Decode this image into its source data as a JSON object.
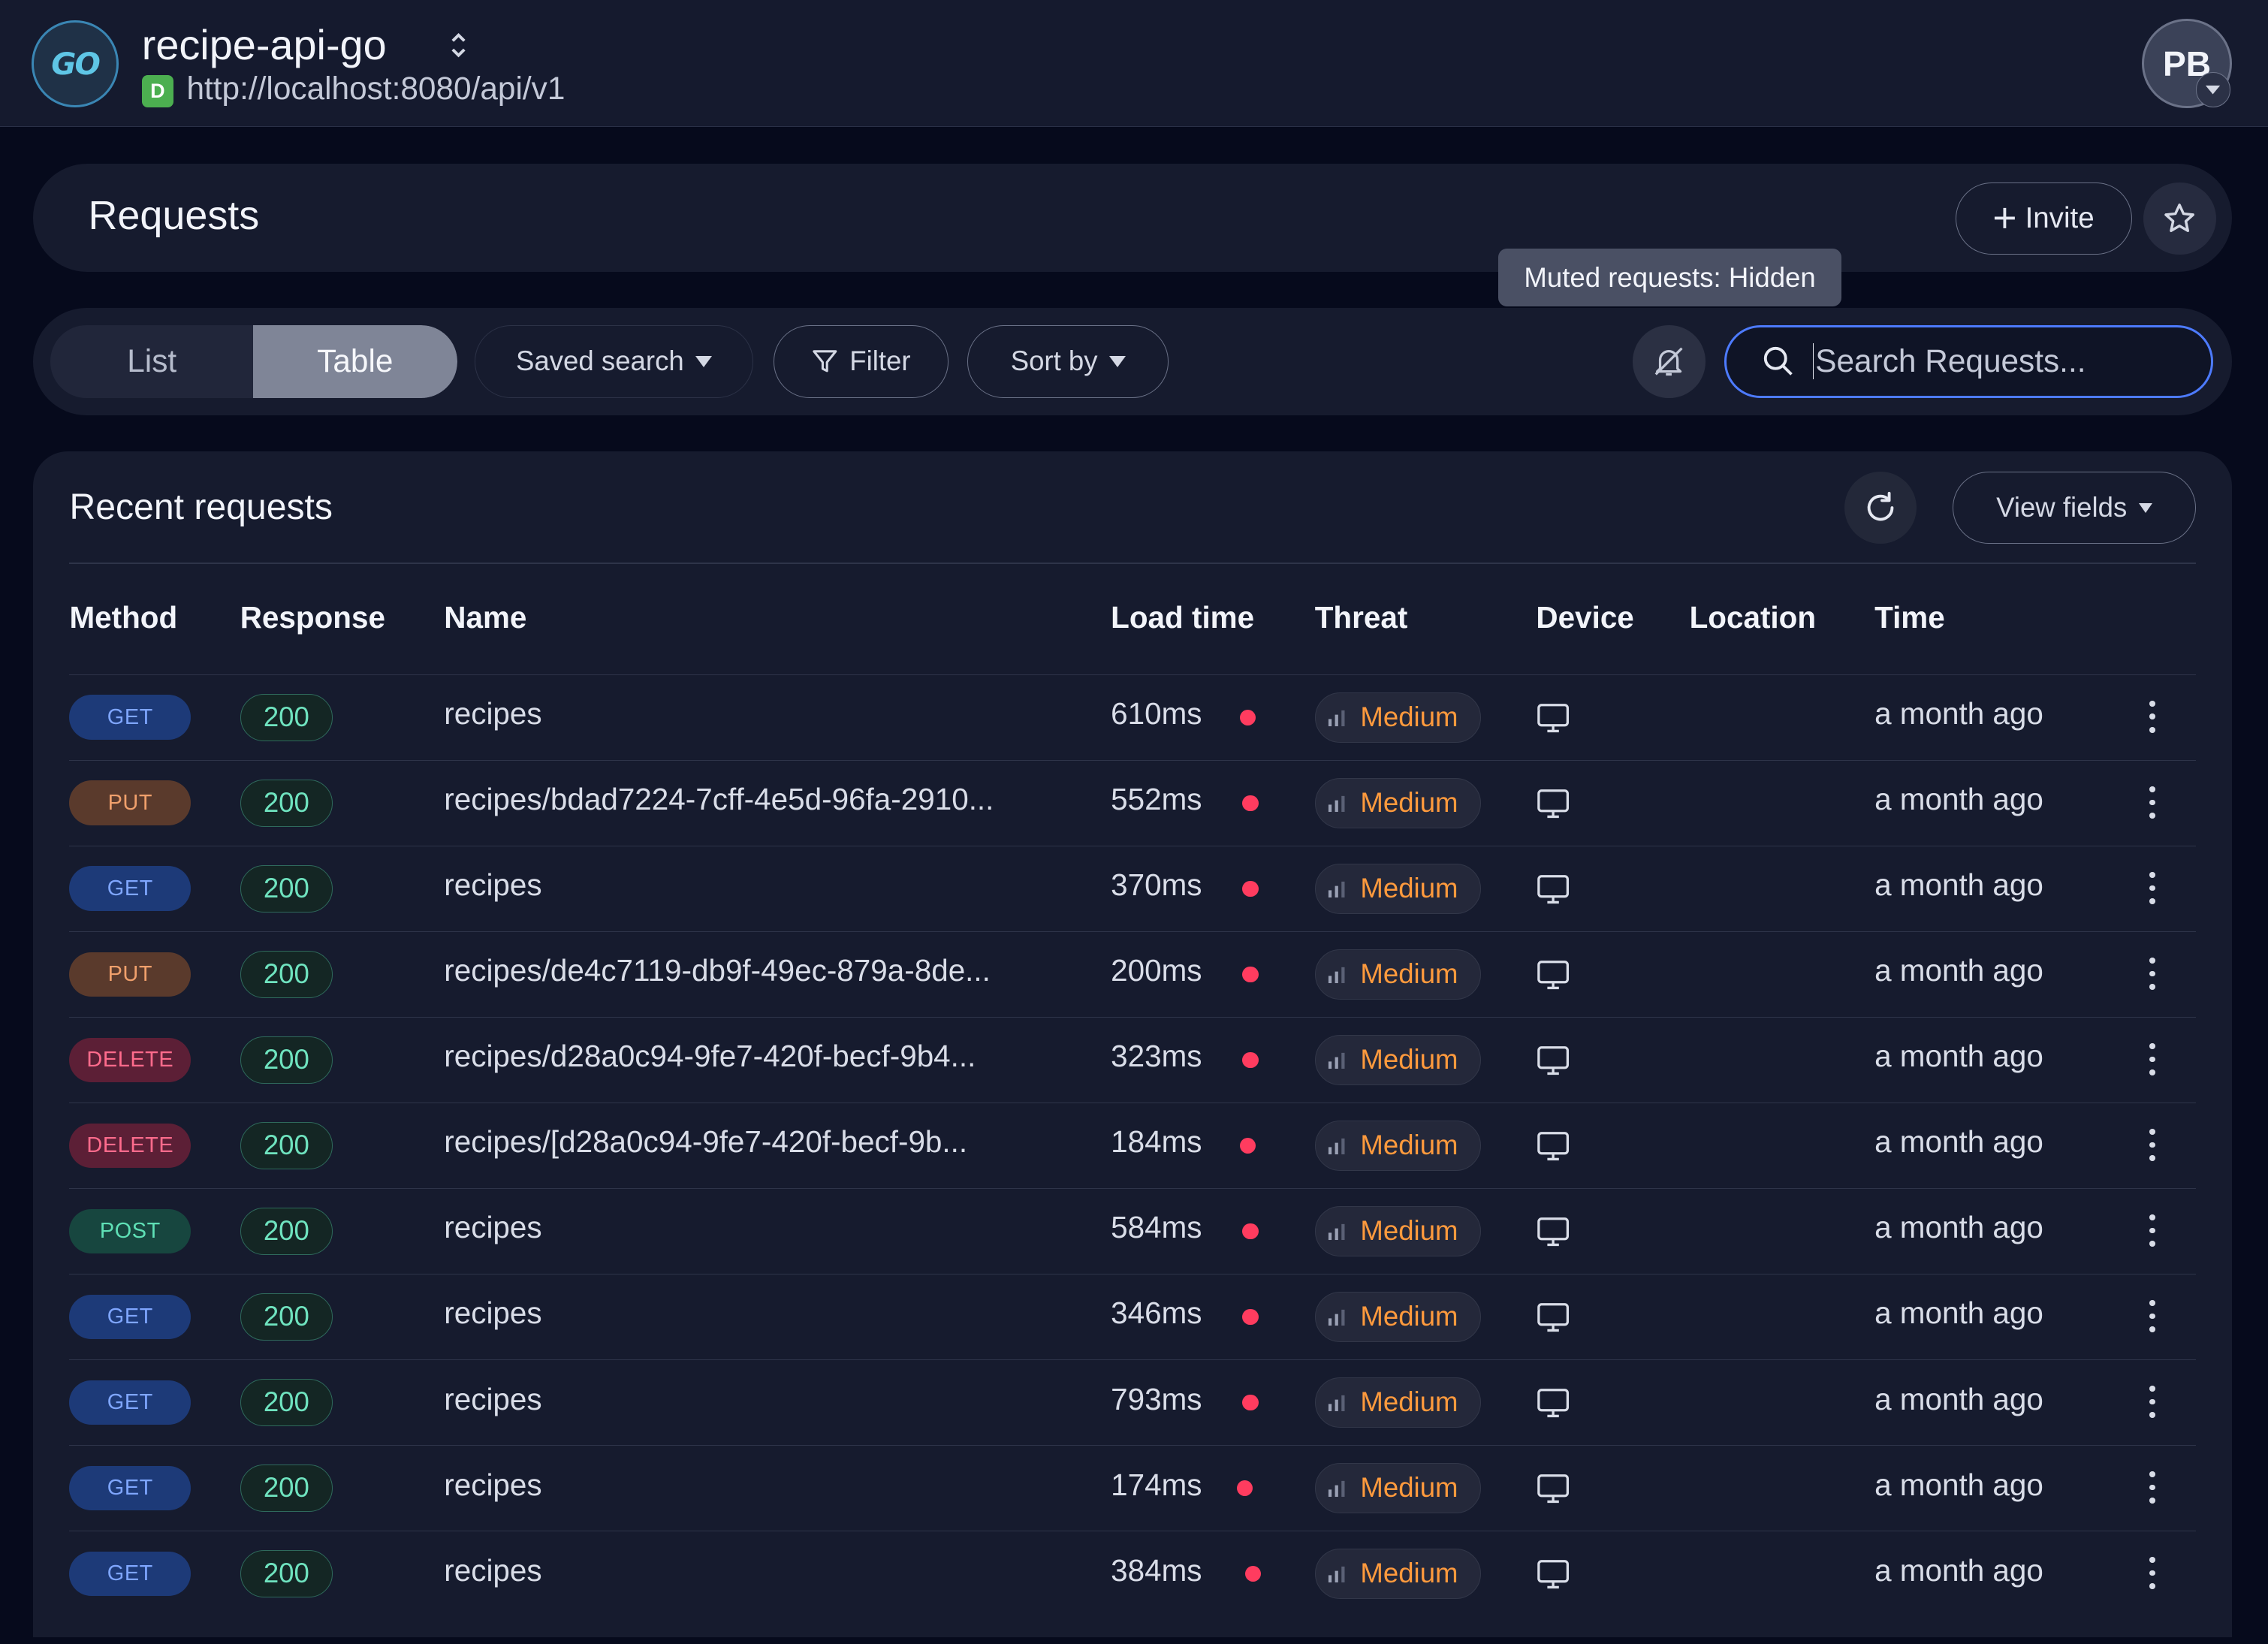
{
  "header": {
    "logo_text": "GO",
    "project_name": "recipe-api-go",
    "env_badge": "D",
    "base_url": "http://localhost:8080/api/v1",
    "avatar_initials": "PB"
  },
  "requests_panel": {
    "title": "Requests",
    "invite_label": "Invite"
  },
  "tooltip": "Muted requests: Hidden",
  "toolbar": {
    "view_list": "List",
    "view_table": "Table",
    "active_view": "Table",
    "saved_search": "Saved search",
    "filter": "Filter",
    "sort_by": "Sort by",
    "search_placeholder": "Search Requests..."
  },
  "table": {
    "title": "Recent requests",
    "view_fields": "View fields",
    "columns": [
      "Method",
      "Response",
      "Name",
      "Load time",
      "Threat",
      "Device",
      "Location",
      "Time"
    ],
    "rows": [
      {
        "method": "GET",
        "status": "200",
        "name": "recipes",
        "load": "610ms",
        "threat": "Medium",
        "location": "",
        "time": "a month ago"
      },
      {
        "method": "PUT",
        "status": "200",
        "name": "recipes/bdad7224-7cff-4e5d-96fa-2910...",
        "load": "552ms",
        "threat": "Medium",
        "location": "",
        "time": "a month ago"
      },
      {
        "method": "GET",
        "status": "200",
        "name": "recipes",
        "load": "370ms",
        "threat": "Medium",
        "location": "",
        "time": "a month ago"
      },
      {
        "method": "PUT",
        "status": "200",
        "name": "recipes/de4c7119-db9f-49ec-879a-8de...",
        "load": "200ms",
        "threat": "Medium",
        "location": "",
        "time": "a month ago"
      },
      {
        "method": "DELETE",
        "status": "200",
        "name": "recipes/d28a0c94-9fe7-420f-becf-9b4...",
        "load": "323ms",
        "threat": "Medium",
        "location": "",
        "time": "a month ago"
      },
      {
        "method": "DELETE",
        "status": "200",
        "name": "recipes/[d28a0c94-9fe7-420f-becf-9b...",
        "load": "184ms",
        "threat": "Medium",
        "location": "",
        "time": "a month ago"
      },
      {
        "method": "POST",
        "status": "200",
        "name": "recipes",
        "load": "584ms",
        "threat": "Medium",
        "location": "",
        "time": "a month ago"
      },
      {
        "method": "GET",
        "status": "200",
        "name": "recipes",
        "load": "346ms",
        "threat": "Medium",
        "location": "",
        "time": "a month ago"
      },
      {
        "method": "GET",
        "status": "200",
        "name": "recipes",
        "load": "793ms",
        "threat": "Medium",
        "location": "",
        "time": "a month ago"
      },
      {
        "method": "GET",
        "status": "200",
        "name": "recipes",
        "load": "174ms",
        "threat": "Medium",
        "location": "",
        "time": "a month ago"
      },
      {
        "method": "GET",
        "status": "200",
        "name": "recipes",
        "load": "384ms",
        "threat": "Medium",
        "location": "",
        "time": "a month ago"
      }
    ]
  },
  "colors": {
    "background": "#060a1c",
    "panel": "#161b2e",
    "accent_blue": "#4d7bff",
    "status_green": "#6fe3bf",
    "threat_orange": "#ff9a3d",
    "load_dot_red": "#ff3c5f"
  },
  "icons": {
    "sort_project": "updown-chevron-icon",
    "invite": "plus-icon",
    "favorite": "star-icon",
    "filter": "funnel-icon",
    "mute": "bell-off-icon",
    "search": "search-icon",
    "refresh": "refresh-icon",
    "threat": "signal-bars-icon",
    "device": "monitor-icon",
    "row_menu": "kebab-menu-icon"
  }
}
